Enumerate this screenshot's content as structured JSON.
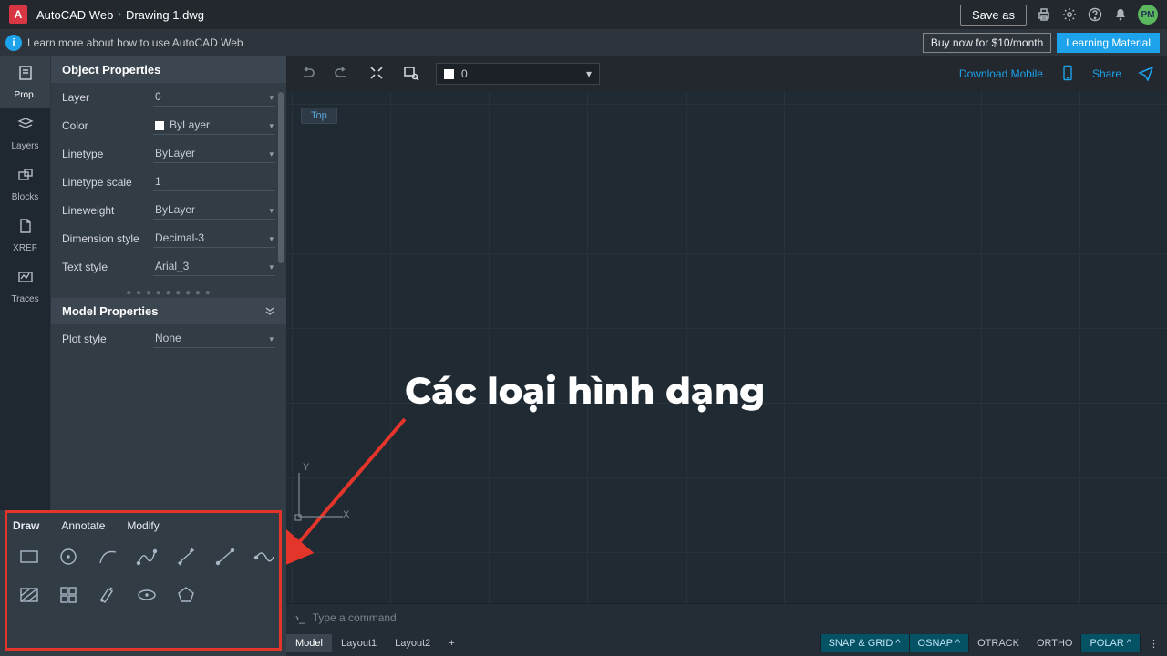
{
  "topbar": {
    "app": "AutoCAD Web",
    "file": "Drawing 1.dwg",
    "save": "Save as",
    "avatar": "PM"
  },
  "infobar": {
    "msg": "Learn more about how to use AutoCAD Web",
    "buy": "Buy now for $10/month",
    "learn": "Learning Material"
  },
  "rail": [
    {
      "label": "Prop."
    },
    {
      "label": "Layers"
    },
    {
      "label": "Blocks"
    },
    {
      "label": "XREF"
    },
    {
      "label": "Traces"
    }
  ],
  "object_props": {
    "title": "Object Properties",
    "rows": [
      {
        "lbl": "Layer",
        "val": "0"
      },
      {
        "lbl": "Color",
        "val": "ByLayer"
      },
      {
        "lbl": "Linetype",
        "val": "ByLayer"
      },
      {
        "lbl": "Linetype scale",
        "val": "1"
      },
      {
        "lbl": "Lineweight",
        "val": "ByLayer"
      },
      {
        "lbl": "Dimension style",
        "val": "Decimal-3"
      },
      {
        "lbl": "Text style",
        "val": "Arial_3"
      }
    ]
  },
  "model_props": {
    "title": "Model Properties",
    "rows": [
      {
        "lbl": "Plot style",
        "val": "None"
      }
    ]
  },
  "toolbar": {
    "layer": "0",
    "download": "Download Mobile",
    "share": "Share"
  },
  "canvas": {
    "view": "Top",
    "axisX": "X",
    "axisY": "Y",
    "annotation": "Các loại hình dạng"
  },
  "cmd": {
    "placeholder": "Type a command"
  },
  "status": {
    "tabs": [
      "Model",
      "Layout1",
      "Layout2"
    ],
    "toggles": [
      "SNAP & GRID",
      "OSNAP",
      "OTRACK",
      "ORTHO",
      "POLAR"
    ]
  },
  "tools": {
    "tabs": [
      "Draw",
      "Annotate",
      "Modify"
    ],
    "items": [
      "rectangle",
      "circle",
      "arc",
      "polyline",
      "dim-line",
      "diag-line",
      "rev-cloud",
      "hatch",
      "grid4",
      "hatch-wand",
      "ellipse",
      "polygon"
    ]
  }
}
